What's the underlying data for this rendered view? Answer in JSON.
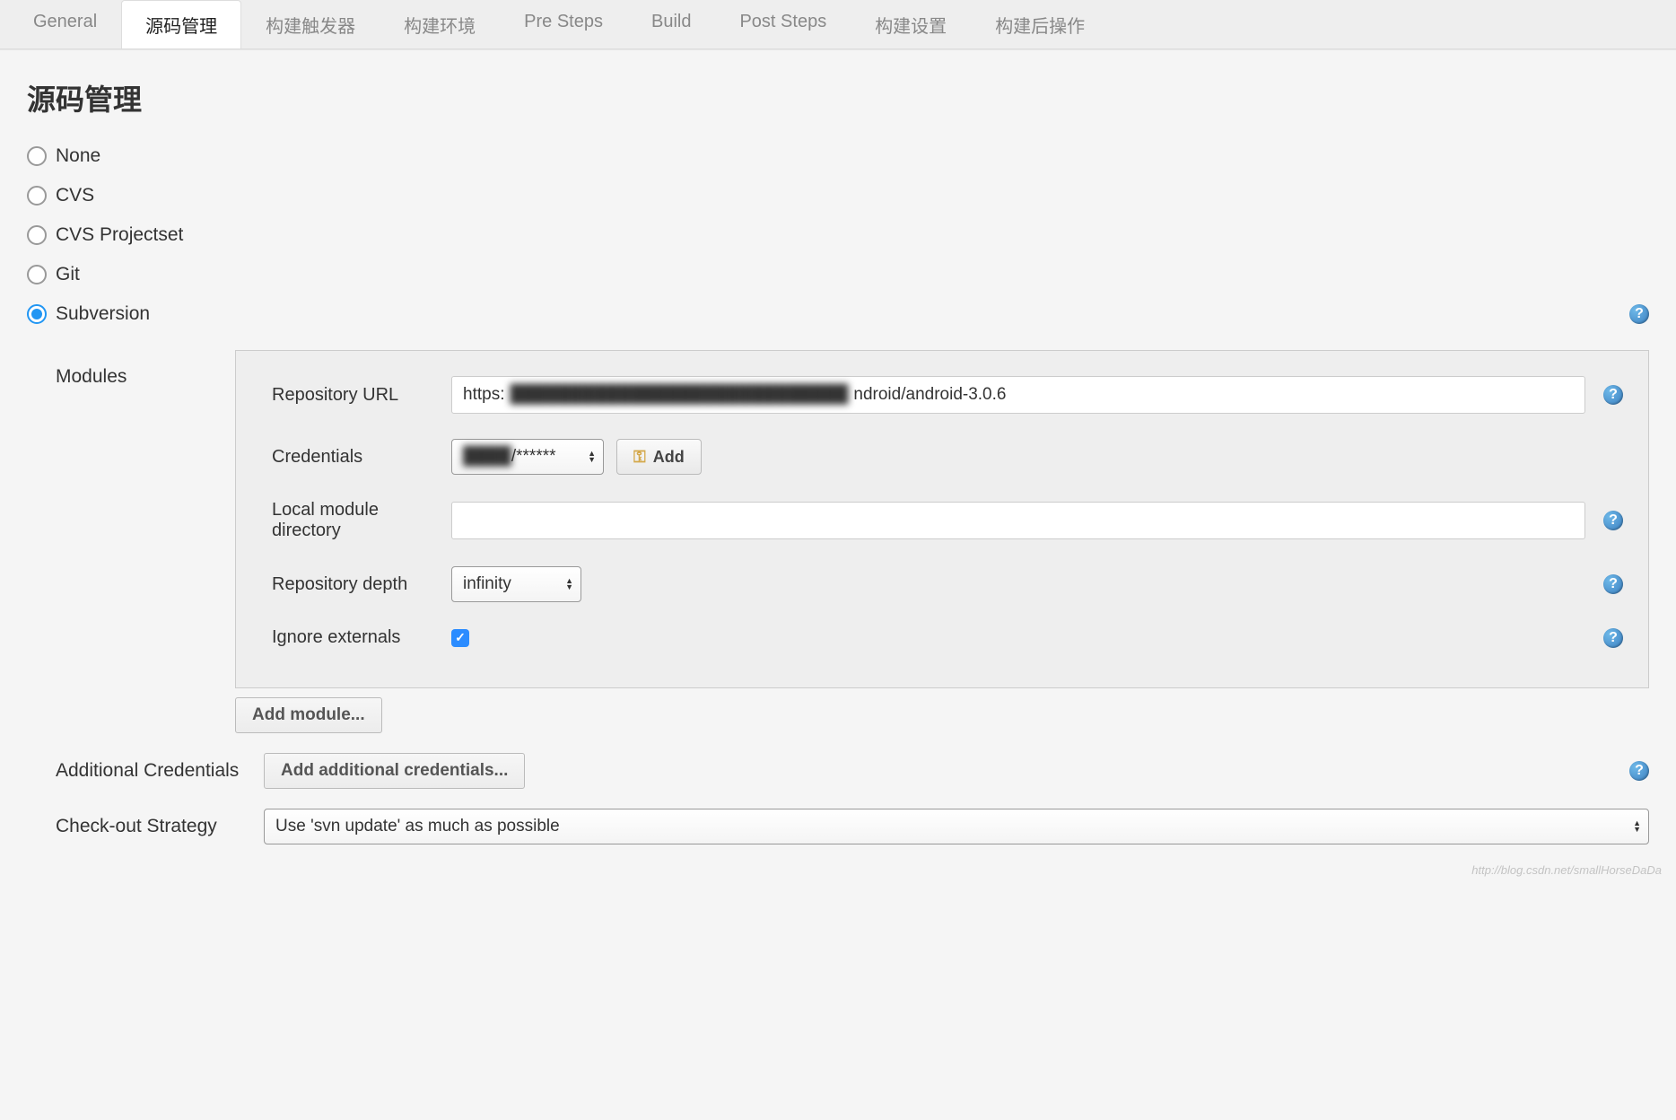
{
  "tabs": {
    "items": [
      {
        "label": "General"
      },
      {
        "label": "源码管理"
      },
      {
        "label": "构建触发器"
      },
      {
        "label": "构建环境"
      },
      {
        "label": "Pre Steps"
      },
      {
        "label": "Build"
      },
      {
        "label": "Post Steps"
      },
      {
        "label": "构建设置"
      },
      {
        "label": "构建后操作"
      }
    ],
    "active_index": 1
  },
  "section_title": "源码管理",
  "scm_options": [
    {
      "label": "None",
      "selected": false
    },
    {
      "label": "CVS",
      "selected": false
    },
    {
      "label": "CVS Projectset",
      "selected": false
    },
    {
      "label": "Git",
      "selected": false
    },
    {
      "label": "Subversion",
      "selected": true
    }
  ],
  "modules": {
    "label": "Modules",
    "repository_url": {
      "label": "Repository URL",
      "value_prefix": "https:",
      "value_blurred": "████████████████████████████",
      "value_suffix": "ndroid/android-3.0.6"
    },
    "credentials": {
      "label": "Credentials",
      "selected_blurred": "████",
      "selected_suffix": "/******",
      "add_button": "Add"
    },
    "local_module_dir": {
      "label": "Local module directory",
      "value": ""
    },
    "repository_depth": {
      "label": "Repository depth",
      "selected": "infinity"
    },
    "ignore_externals": {
      "label": "Ignore externals",
      "checked": true
    },
    "add_module_button": "Add module..."
  },
  "additional_credentials": {
    "label": "Additional Credentials",
    "button": "Add additional credentials..."
  },
  "checkout_strategy": {
    "label": "Check-out Strategy",
    "selected": "Use 'svn update' as much as possible"
  },
  "watermark": "http://blog.csdn.net/smallHorseDaDa"
}
